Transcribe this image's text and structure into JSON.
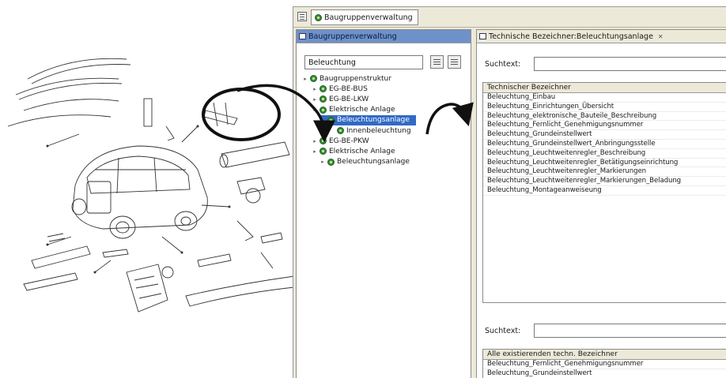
{
  "app": {
    "tab_label": "Baugruppenverwaltung"
  },
  "left_pane": {
    "title": "Baugruppenverwaltung",
    "filter_value": "Beleuchtung",
    "tree": [
      {
        "label": "Baugruppenstruktur",
        "level": 0,
        "selected": false
      },
      {
        "label": "EG-BE-BUS",
        "level": 1,
        "selected": false
      },
      {
        "label": "EG-BE-LKW",
        "level": 1,
        "selected": false
      },
      {
        "label": "Elektrische Anlage",
        "level": 2,
        "selected": false
      },
      {
        "label": "Beleuchtungsanlage",
        "level": 3,
        "selected": true
      },
      {
        "label": "Innenbeleuchtung",
        "level": 4,
        "selected": false
      },
      {
        "label": "EG-BE-PKW",
        "level": 1,
        "selected": false
      },
      {
        "label": "Elektrische Anlage",
        "level": 2,
        "selected": false
      },
      {
        "label": "Beleuchtungsanlage",
        "level": 3,
        "selected": false
      }
    ]
  },
  "right_pane": {
    "title": "Technische Bezeichner:Beleuchtungsanlage",
    "close_glyph": "✕",
    "search_label_1": "Suchtext:",
    "search_label_2": "Suchtext:",
    "table1_header": "Technischer Bezeichner",
    "table1_rows": [
      "Beleuchtung_Einbau",
      "Beleuchtung_Einrichtungen_Übersicht",
      "Beleuchtung_elektronische_Bauteile_Beschreibung",
      "Beleuchtung_Fernlicht_Genehmigungsnummer",
      "Beleuchtung_Grundeinstellwert",
      "Beleuchtung_Grundeinstellwert_Anbringungsstelle",
      "Beleuchtung_Leuchtweitenregler_Beschreibung",
      "Beleuchtung_Leuchtweitenregler_Betätigungseinrichtung",
      "Beleuchtung_Leuchtweitenregler_Markierungen",
      "Beleuchtung_Leuchtweitenregler_Markierungen_Beladung",
      "Beleuchtung_Montageanweiseung"
    ],
    "table2_header": "Alle existierenden techn. Bezeichner",
    "table2_rows": [
      "Beleuchtung_Fernlicht_Genehmigungsnummer",
      "Beleuchtung_Grundeinstellwert"
    ]
  },
  "colors": {
    "selection": "#316ac5",
    "active_title": "#6e91c9",
    "window_bg": "#ece9d8",
    "tree_icon": "#2f8f3a"
  },
  "icons": [
    "menu-icon",
    "gear-icon",
    "view-icon",
    "close-icon",
    "collapse-icon",
    "filter-icon",
    "twisty-icon"
  ]
}
